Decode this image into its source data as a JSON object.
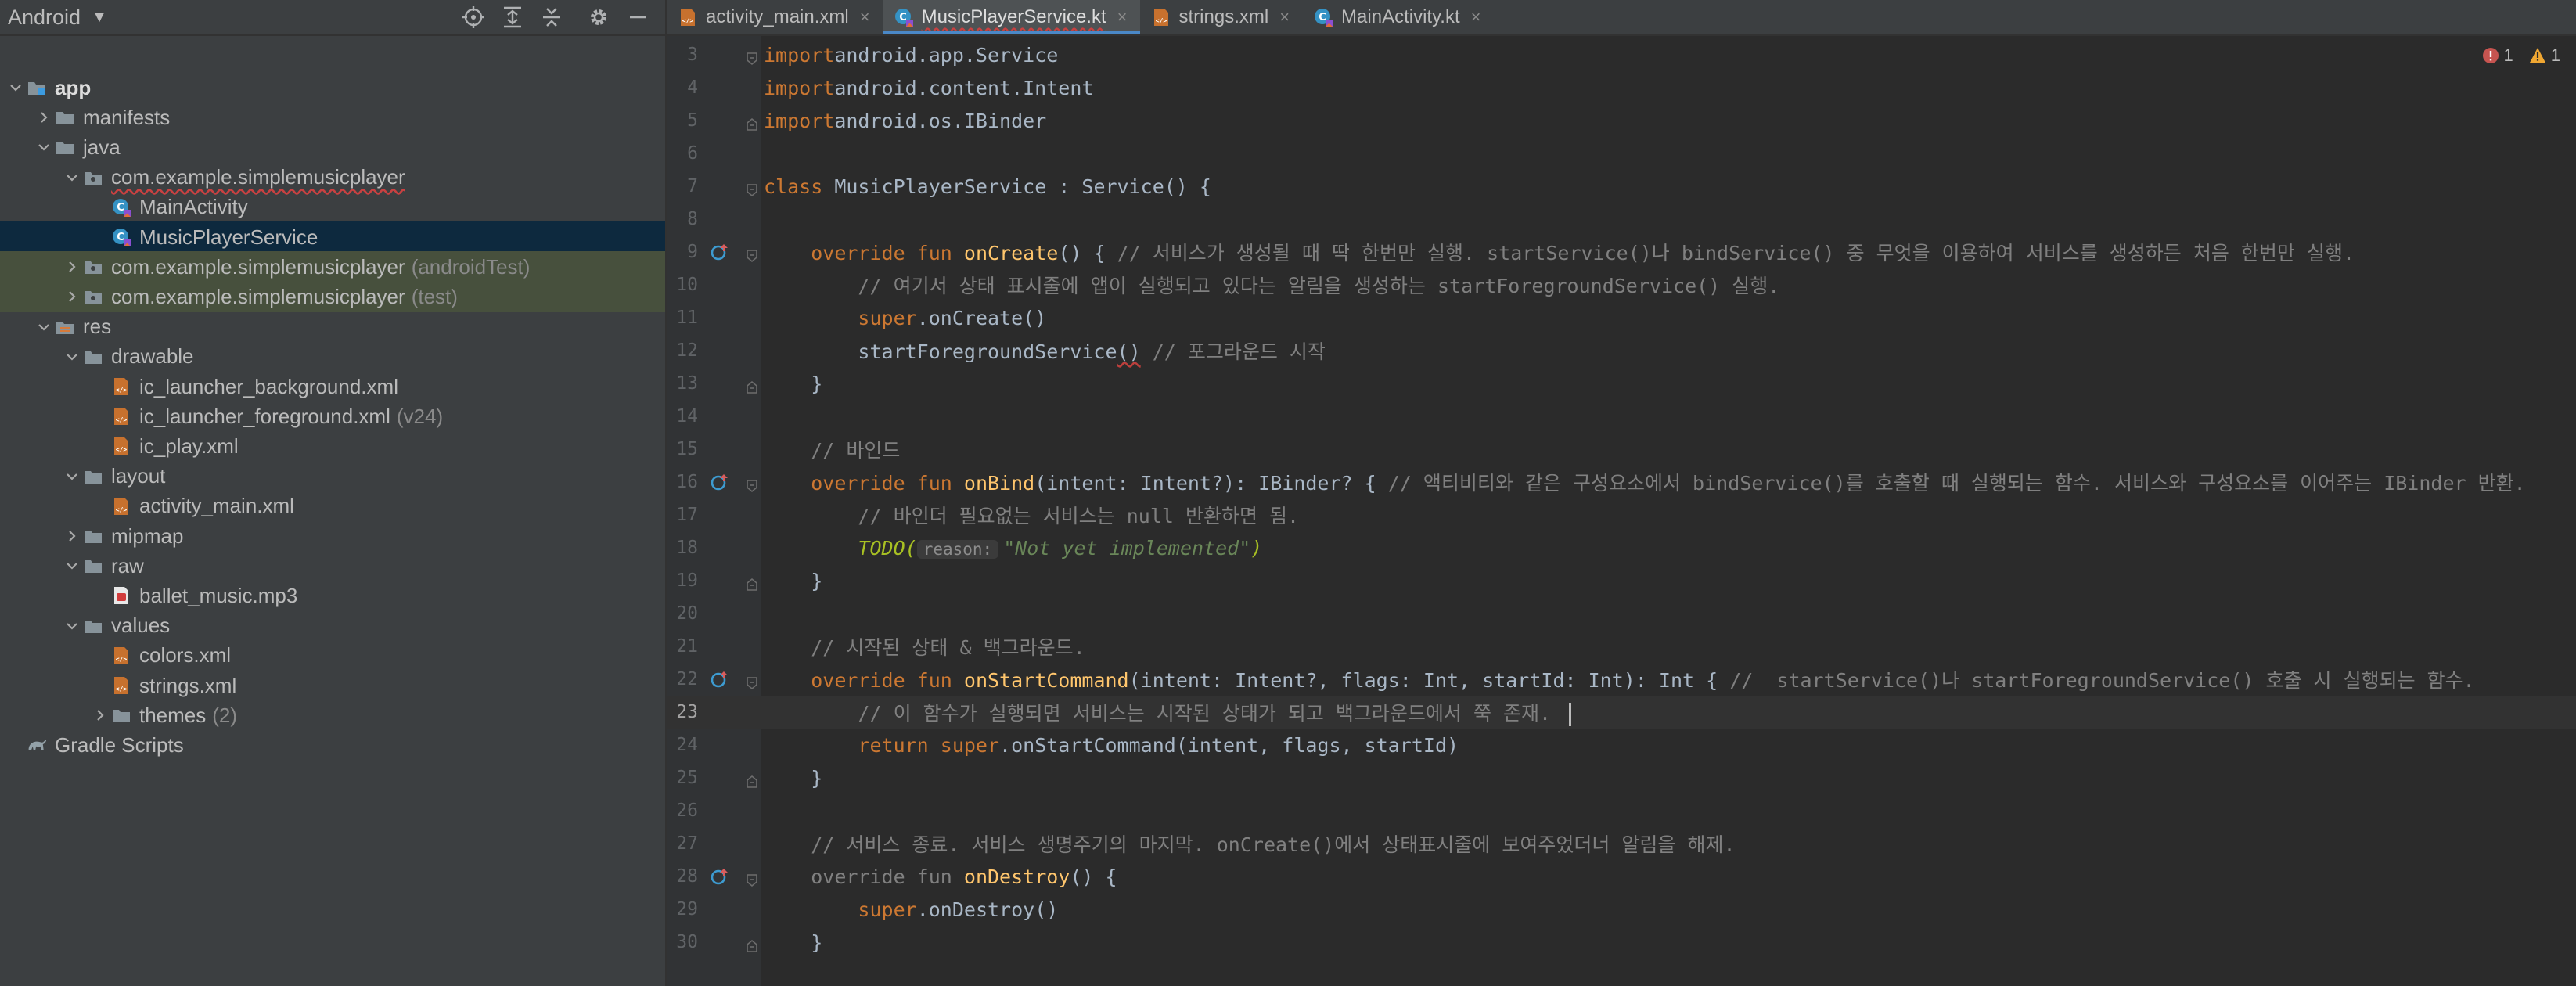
{
  "project_panel": {
    "view_mode": "Android",
    "toolbar_icons": [
      "locate-icon",
      "expand-all-icon",
      "collapse-all-icon",
      "gear-icon",
      "minimize-icon"
    ],
    "tree": [
      {
        "label": "app",
        "suffix": "",
        "icon": "module-folder-icon",
        "chevron": "down",
        "indent": 0,
        "bold": true
      },
      {
        "label": "manifests",
        "suffix": "",
        "icon": "folder-icon",
        "chevron": "right",
        "indent": 1
      },
      {
        "label": "java",
        "suffix": "",
        "icon": "folder-icon",
        "chevron": "down",
        "indent": 1
      },
      {
        "label": "com.example.simplemusicplayer",
        "suffix": "",
        "icon": "package-icon",
        "chevron": "down",
        "indent": 2,
        "underline": true
      },
      {
        "label": "MainActivity",
        "suffix": "",
        "icon": "kotlin-class-icon",
        "chevron": "",
        "indent": 3
      },
      {
        "label": "MusicPlayerService",
        "suffix": "",
        "icon": "kotlin-class-icon",
        "chevron": "",
        "indent": 3,
        "selected": true
      },
      {
        "label": "com.example.simplemusicplayer",
        "suffix": "(androidTest)",
        "icon": "package-icon",
        "chevron": "right",
        "indent": 2,
        "green": true
      },
      {
        "label": "com.example.simplemusicplayer",
        "suffix": "(test)",
        "icon": "package-icon",
        "chevron": "right",
        "indent": 2,
        "green": true
      },
      {
        "label": "res",
        "suffix": "",
        "icon": "res-folder-icon",
        "chevron": "down",
        "indent": 1
      },
      {
        "label": "drawable",
        "suffix": "",
        "icon": "folder-icon",
        "chevron": "down",
        "indent": 2
      },
      {
        "label": "ic_launcher_background.xml",
        "suffix": "",
        "icon": "xml-file-icon",
        "chevron": "",
        "indent": 3
      },
      {
        "label": "ic_launcher_foreground.xml",
        "suffix": "(v24)",
        "icon": "xml-file-icon",
        "chevron": "",
        "indent": 3
      },
      {
        "label": "ic_play.xml",
        "suffix": "",
        "icon": "xml-file-icon",
        "chevron": "",
        "indent": 3
      },
      {
        "label": "layout",
        "suffix": "",
        "icon": "folder-icon",
        "chevron": "down",
        "indent": 2
      },
      {
        "label": "activity_main.xml",
        "suffix": "",
        "icon": "xml-file-icon",
        "chevron": "",
        "indent": 3
      },
      {
        "label": "mipmap",
        "suffix": "",
        "icon": "folder-icon",
        "chevron": "right",
        "indent": 2
      },
      {
        "label": "raw",
        "suffix": "",
        "icon": "folder-icon",
        "chevron": "down",
        "indent": 2
      },
      {
        "label": "ballet_music.mp3",
        "suffix": "",
        "icon": "audio-file-icon",
        "chevron": "",
        "indent": 3
      },
      {
        "label": "values",
        "suffix": "",
        "icon": "folder-icon",
        "chevron": "down",
        "indent": 2
      },
      {
        "label": "colors.xml",
        "suffix": "",
        "icon": "xml-file-icon",
        "chevron": "",
        "indent": 3
      },
      {
        "label": "strings.xml",
        "suffix": "",
        "icon": "xml-file-icon",
        "chevron": "",
        "indent": 3
      },
      {
        "label": "themes",
        "suffix": "(2)",
        "icon": "folder-icon",
        "chevron": "right",
        "indent": 3
      },
      {
        "label": "Gradle Scripts",
        "suffix": "",
        "icon": "gradle-icon",
        "chevron": "",
        "indent": 0
      }
    ]
  },
  "editor": {
    "tabs": [
      {
        "label": "activity_main.xml",
        "icon": "xml-file-icon",
        "active": false
      },
      {
        "label": "MusicPlayerService.kt",
        "icon": "kotlin-class-icon",
        "active": true
      },
      {
        "label": "strings.xml",
        "icon": "xml-file-icon",
        "active": false
      },
      {
        "label": "MainActivity.kt",
        "icon": "kotlin-class-icon",
        "active": false
      }
    ],
    "close_glyph": "×",
    "error_count": "1",
    "warning_count": "1",
    "current_line": "23",
    "lines": [
      {
        "n": "3",
        "fold": "start",
        "tokens": [
          [
            "kw",
            "import"
          ],
          [
            "",
            "android.app.Service"
          ]
        ]
      },
      {
        "n": "4",
        "tokens": [
          [
            "kw",
            "import"
          ],
          [
            "",
            "android.content.Intent"
          ]
        ]
      },
      {
        "n": "5",
        "fold": "end",
        "tokens": [
          [
            "kw",
            "import"
          ],
          [
            "",
            "android.os.IBinder"
          ]
        ]
      },
      {
        "n": "6",
        "tokens": []
      },
      {
        "n": "7",
        "fold": "start",
        "tokens": [
          [
            "kw",
            "class"
          ],
          [
            "",
            " MusicPlayerService : Service() {"
          ]
        ]
      },
      {
        "n": "8",
        "tokens": []
      },
      {
        "n": "9",
        "gutter": "override-icon",
        "fold": "start",
        "tokens": [
          [
            "",
            "    "
          ],
          [
            "kw",
            "override fun "
          ],
          [
            "fn",
            "onCreate"
          ],
          [
            "",
            "() { "
          ],
          [
            "cm",
            "// 서비스가 생성될 때 딱 한번만 실행. startService()나 bindService() 중 무엇을 이용하여 서비스를 생성하든 처음 한번만 실행."
          ]
        ]
      },
      {
        "n": "10",
        "tokens": [
          [
            "",
            "        "
          ],
          [
            "cm",
            "// 여기서 상태 표시줄에 앱이 실행되고 있다는 알림을 생성하는 startForegroundService() 실행."
          ]
        ]
      },
      {
        "n": "11",
        "tokens": [
          [
            "",
            "        "
          ],
          [
            "kw",
            "super"
          ],
          [
            "",
            ".onCreate()"
          ]
        ]
      },
      {
        "n": "12",
        "tokens": [
          [
            "",
            "        startForegroundService"
          ],
          [
            "err",
            "()"
          ],
          [
            "",
            ""
          ],
          [
            "cm",
            " // 포그라운드 시작"
          ]
        ]
      },
      {
        "n": "13",
        "fold": "end",
        "tokens": [
          [
            "",
            "    }"
          ]
        ]
      },
      {
        "n": "14",
        "tokens": []
      },
      {
        "n": "15",
        "tokens": [
          [
            "",
            "    "
          ],
          [
            "cm",
            "// 바인드"
          ]
        ]
      },
      {
        "n": "16",
        "gutter": "override-icon",
        "fold": "start",
        "tokens": [
          [
            "",
            "    "
          ],
          [
            "kw",
            "override fun "
          ],
          [
            "fn",
            "onBind"
          ],
          [
            "",
            "(intent: Intent?): IBinder? { "
          ],
          [
            "cm",
            "// 액티비티와 같은 구성요소에서 bindService()를 호출할 때 실행되는 함수. 서비스와 구성요소를 이어주는 IBinder 반환."
          ]
        ]
      },
      {
        "n": "17",
        "tokens": [
          [
            "",
            "        "
          ],
          [
            "cm",
            "// 바인더 필요없는 서비스는 null 반환하면 됨."
          ]
        ]
      },
      {
        "n": "18",
        "tokens": [
          [
            "",
            "        "
          ],
          [
            "todo",
            "TODO("
          ],
          [
            "hint",
            "reason:"
          ],
          [
            "str",
            "\"Not yet implemented\""
          ],
          [
            "todo",
            ")"
          ]
        ]
      },
      {
        "n": "19",
        "fold": "end",
        "tokens": [
          [
            "",
            "    }"
          ]
        ]
      },
      {
        "n": "20",
        "tokens": []
      },
      {
        "n": "21",
        "tokens": [
          [
            "",
            "    "
          ],
          [
            "cm",
            "// 시작된 상태 & 백그라운드."
          ]
        ]
      },
      {
        "n": "22",
        "gutter": "override-icon",
        "fold": "start",
        "tokens": [
          [
            "",
            "    "
          ],
          [
            "kw",
            "override fun "
          ],
          [
            "fn",
            "onStartCommand"
          ],
          [
            "",
            "(intent: Intent?, flags: Int, startId: Int): Int { "
          ],
          [
            "cm",
            "//  startService()나 startForegroundService() 호출 시 실행되는 함수."
          ]
        ]
      },
      {
        "n": "23",
        "current": true,
        "tokens": [
          [
            "",
            "        "
          ],
          [
            "cm",
            "// 이 함수가 실행되면 서비스는 시작된 상태가 되고 백그라운드에서 쭉 존재. "
          ],
          [
            "caret",
            ""
          ]
        ]
      },
      {
        "n": "24",
        "tokens": [
          [
            "",
            "        "
          ],
          [
            "kw",
            "return super"
          ],
          [
            "",
            ".onStartCommand(intent, flags, startId)"
          ]
        ]
      },
      {
        "n": "25",
        "fold": "end",
        "tokens": [
          [
            "",
            "    }"
          ]
        ]
      },
      {
        "n": "26",
        "tokens": []
      },
      {
        "n": "27",
        "tokens": [
          [
            "",
            "    "
          ],
          [
            "cm",
            "// 서비스 종료. 서비스 생명주기의 마지막. onCreate()에서 상태표시줄에 보여주었더너 알림을 해제."
          ]
        ]
      },
      {
        "n": "28",
        "gutter": "override-icon",
        "fold": "start",
        "tokens": [
          [
            "",
            "    "
          ],
          [
            "cm",
            "override fun "
          ],
          [
            "fn",
            "onDestroy"
          ],
          [
            "",
            "() {"
          ]
        ]
      },
      {
        "n": "29",
        "tokens": [
          [
            "",
            "        "
          ],
          [
            "kw",
            "super"
          ],
          [
            "",
            ".onDestroy()"
          ]
        ]
      },
      {
        "n": "30",
        "fold": "end",
        "tokens": [
          [
            "",
            "    }"
          ]
        ]
      }
    ]
  },
  "colors": {
    "panel_bg": "#3c3f41",
    "editor_bg": "#2b2b2b",
    "selection": "#0d293e",
    "test_highlight": "#47503d",
    "keyword": "#cc7832",
    "function": "#ffc66d",
    "comment": "#808080",
    "text": "#a9b7c6",
    "accent": "#4a88c7"
  }
}
